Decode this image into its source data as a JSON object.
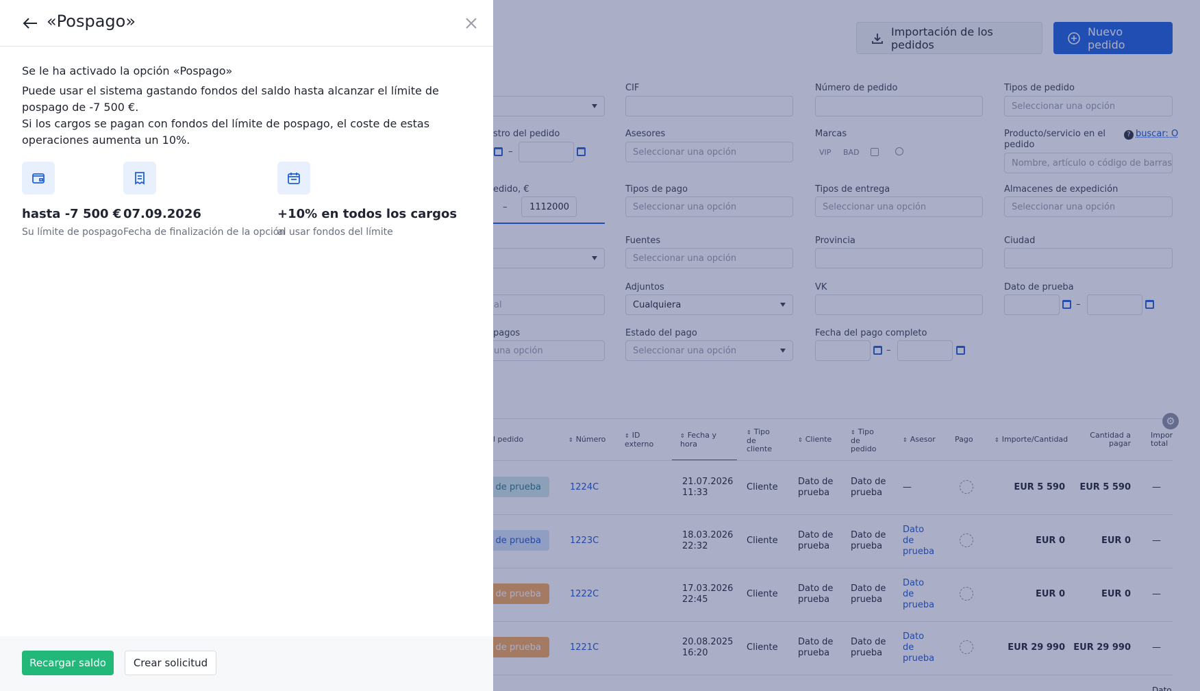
{
  "drawer": {
    "title": "«Pospago»",
    "heading": "Se le ha activado la opción «Pospago»",
    "text": "Puede usar el sistema gastando fondos del saldo hasta alcanzar el límite de pospago de -7 500 €.\nSi los cargos se pagan con fondos del límite de pospago, el coste de estas operaciones aumenta un 10%.",
    "features": [
      {
        "value": "hasta -7 500 €",
        "caption": "Su límite de pospago",
        "icon": "wallet-icon"
      },
      {
        "value": "07.09.2026",
        "caption": "Fecha de finalización de la opción",
        "icon": "receipt-icon"
      },
      {
        "value": "+10% en todos los cargos",
        "caption": "al usar fondos del límite",
        "icon": "calendar-icon"
      }
    ],
    "recharge_label": "Recargar saldo",
    "request_label": "Crear solicitud"
  },
  "header": {
    "import_label": "Importación de los pedidos",
    "new_label": "Nuevo pedido"
  },
  "filters": {
    "cif": "CIF",
    "order_number": "Número de pedido",
    "order_types": "Tipos de pedido",
    "order_types_ph": "Seleccionar una opción",
    "registry_partial": "stro del pedido",
    "advisors": "Asesores",
    "advisors_ph": "Seleccionar una opción",
    "brands": "Marcas",
    "brand_vip": "VIP",
    "brand_bad": "BAD",
    "product": "Producto/servicio en el pedido",
    "product_help": "buscar: O",
    "product_ph": "Nombre, artículo o código de barras",
    "amount_partial": "edido, €",
    "amount_to": "1112000",
    "payment_types": "Tipos de pago",
    "payment_types_ph": "Seleccionar una opción",
    "delivery_types": "Tipos de entrega",
    "delivery_types_ph": "Seleccionar una opción",
    "warehouses": "Almacenes de expedición",
    "warehouses_ph": "Seleccionar una opción",
    "sources": "Fuentes",
    "sources_ph": "Seleccionar una opción",
    "province": "Provincia",
    "city": "Ciudad",
    "partial_input": "al",
    "attachments": "Adjuntos",
    "attachments_value": "Cualquiera",
    "vk": "VK",
    "test_date": "Dato de prueba",
    "payments_partial": "pagos",
    "payments_partial_ph": "una opción",
    "payment_status": "Estado del pago",
    "payment_status_ph": "Seleccionar una opción",
    "full_payment_date": "Fecha del pago completo",
    "range_dash": "–"
  },
  "table": {
    "headers": {
      "order_partial": "l pedido",
      "number": "Número",
      "external_id": "ID externo",
      "datetime": "Fecha y hora",
      "client_type": "Tipo de cliente",
      "client": "Cliente",
      "order_type": "Tipo de pedido",
      "advisor": "Asesor",
      "payment": "Pago",
      "amount_qty": "Importe/Cantidad",
      "to_pay": "Cantidad a pagar",
      "total_partial": "Impor total"
    },
    "rows": [
      {
        "status": "to de prueba",
        "number": "1224C",
        "date": "21.07.2026",
        "time": "11:33",
        "client_type": "Cliente",
        "client": "Dato de prueba",
        "order_type": "Dato de prueba",
        "advisor": "—",
        "amount": "EUR 5 590",
        "to_pay": "EUR 5 590",
        "total": "—",
        "badge_color": "#cfe8ec",
        "badge_text": "#2a7a80"
      },
      {
        "status": "to de prueba",
        "number": "1223C",
        "date": "18.03.2026",
        "time": "22:32",
        "client_type": "Cliente",
        "client": "Dato de prueba",
        "order_type": "Dato de prueba",
        "advisor": "Dato de prueba",
        "amount": "EUR 0",
        "to_pay": "EUR 0",
        "total": "—",
        "badge_color": "#d6e4fb",
        "badge_text": "#1f55c8"
      },
      {
        "status": "to de prueba",
        "number": "1222C",
        "date": "17.03.2026",
        "time": "22:45",
        "client_type": "Cliente",
        "client": "Dato de prueba",
        "order_type": "Dato de prueba",
        "advisor": "Dato de prueba",
        "amount": "EUR 0",
        "to_pay": "EUR 0",
        "total": "—",
        "badge_color": "#f5a85a",
        "badge_text": "#ffffff"
      },
      {
        "status": "to de prueba",
        "number": "1221C",
        "date": "20.08.2025",
        "time": "16:20",
        "client_type": "Cliente",
        "client": "Dato de prueba",
        "order_type": "Dato de prueba",
        "advisor": "Dato de prueba",
        "amount": "EUR 29 990",
        "to_pay": "EUR 29 990",
        "total": "—",
        "badge_color": "#f5a85a",
        "badge_text": "#ffffff"
      }
    ],
    "partial_last": "Dato"
  },
  "colors": {
    "primary": "#1a5fe0",
    "success": "#22b87a",
    "overlay": "#2b3570"
  }
}
